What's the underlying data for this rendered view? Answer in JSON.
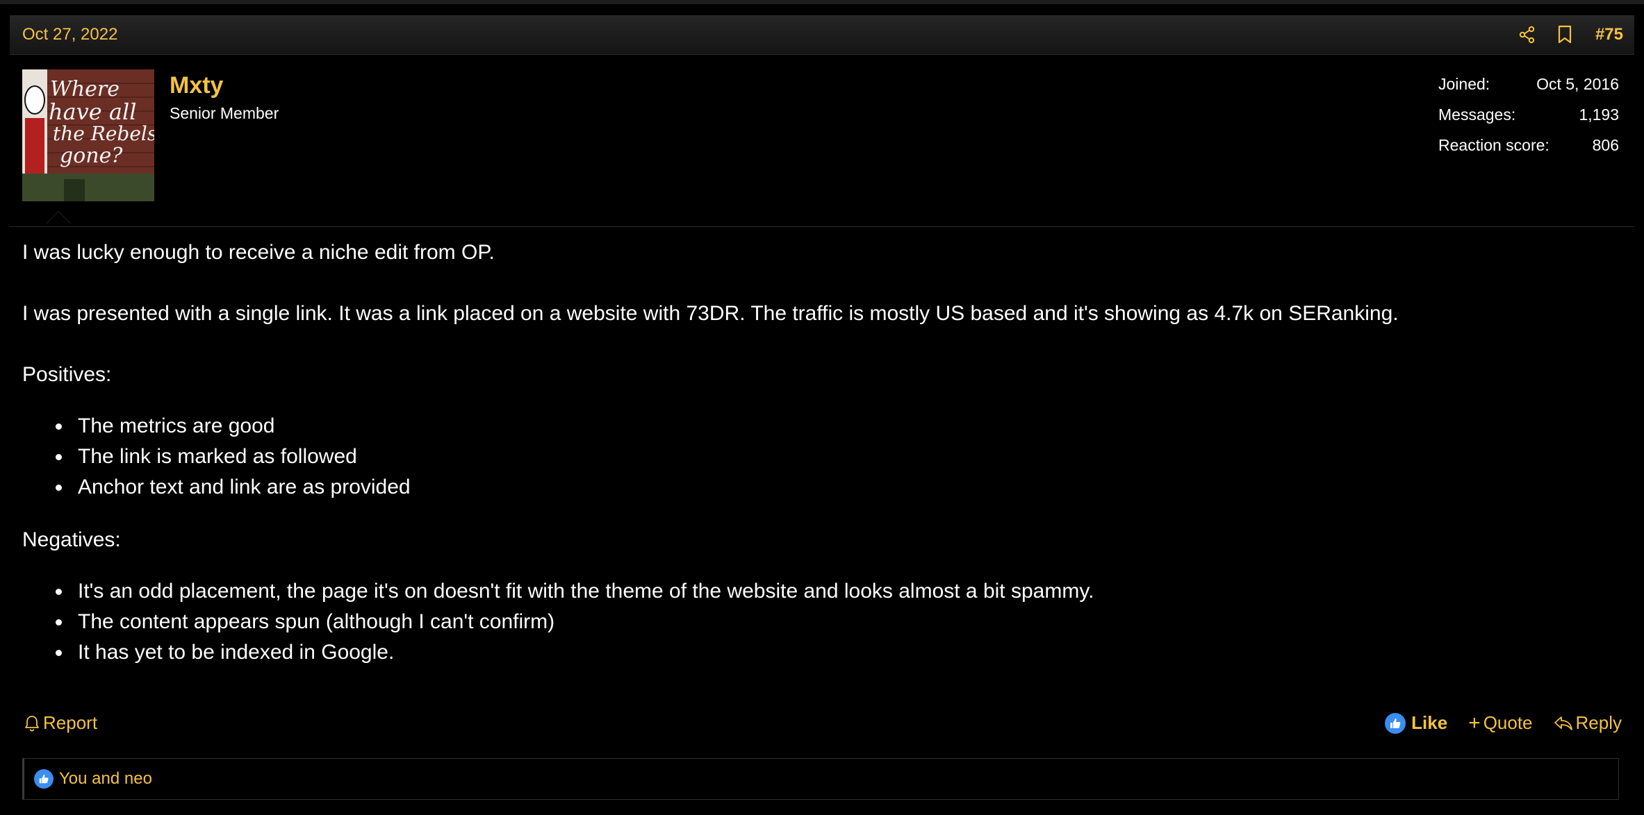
{
  "post": {
    "date": "Oct 27, 2022",
    "number": "#75",
    "header_icons": [
      "share-icon",
      "bookmark-icon"
    ]
  },
  "user": {
    "name": "Mxty",
    "title": "Senior Member",
    "avatar_text": "Where have all the Rebels gone?",
    "extras": [
      {
        "label": "Joined:",
        "value": "Oct 5, 2016"
      },
      {
        "label": "Messages:",
        "value": "1,193"
      },
      {
        "label": "Reaction score:",
        "value": "806"
      }
    ]
  },
  "body": {
    "para1": "I was lucky enough to receive a niche edit from OP.",
    "para2": "I was presented with a single link. It was a link placed on a website with 73DR. The traffic is mostly US based and it's showing as 4.7k on SERanking.",
    "positives_heading": "Positives:",
    "positives": [
      "The metrics are good",
      "The link is marked as followed",
      "Anchor text and link are as provided"
    ],
    "negatives_heading": "Negatives:",
    "negatives": [
      "It's an odd placement, the page it's on doesn't fit with the theme of the website and looks almost a bit spammy.",
      "The content appears spun (although I can't confirm)",
      "It has yet to be indexed in Google."
    ]
  },
  "actions": {
    "report": "Report",
    "like": "Like",
    "quote": "Quote",
    "reply": "Reply"
  },
  "reactions": {
    "text": "You and neo"
  },
  "colors": {
    "accent": "#f5c242",
    "like_blue": "#3a8ef0",
    "background": "#000000"
  }
}
